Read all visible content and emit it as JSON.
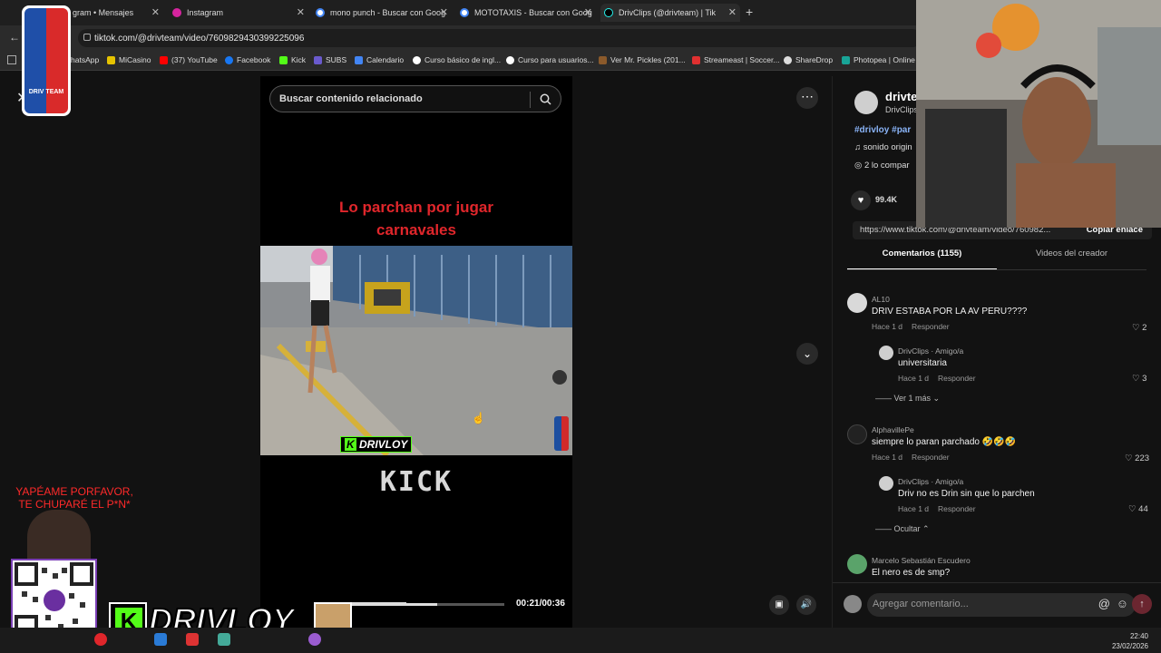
{
  "tabs": [
    {
      "label": "gram • Mensajes"
    },
    {
      "label": "Instagram"
    },
    {
      "label": "mono punch - Buscar con Goog"
    },
    {
      "label": "MOTOTAXIS - Buscar con Goog"
    },
    {
      "label": "DrivClips (@drivteam) | Tik"
    }
  ],
  "address": {
    "url": "tiktok.com/@drivteam/video/7609829430399225096"
  },
  "bookmarks": [
    "hatsApp",
    "MiCasino",
    "(37) YouTube",
    "Facebook",
    "Kick",
    "SUBS",
    "Calendario",
    "Curso básico de ingl...",
    "Curso para usuarios...",
    "Ver Mr. Pickles (201...",
    "Streameast | Soccer...",
    "ShareDrop",
    "Photopea | Online E"
  ],
  "video": {
    "search_placeholder": "Buscar contenido relacionado",
    "title_line1": "Lo parchan por jugar",
    "title_line2": "carnavales",
    "watermark": "DRIVLOY",
    "kick_logo": "KICK",
    "time": "00:21/00:36",
    "progress": 0.58
  },
  "author": {
    "handle": "drivte",
    "name": "DrivClips",
    "hashtags": "#drivloy #par",
    "sound": "sonido origin",
    "shares": "2 lo compar",
    "likes": "99.4K"
  },
  "link": {
    "url": "https://www.tiktok.com/@drivteam/video/760982...",
    "copy_label": "Copiar enlace"
  },
  "tabs_panel": {
    "comments": "Comentarios (1155)",
    "creator": "Videos del creador"
  },
  "comments": [
    {
      "name": "AL10",
      "text": "DRIV ESTABA POR LA AV PERU????",
      "time": "Hace 1 d",
      "reply": "Responder",
      "likes": "2"
    },
    {
      "name": "DrivClips · Amigo/a",
      "text": "universitaria",
      "time": "Hace 1 d",
      "reply": "Responder",
      "likes": "3"
    },
    {
      "name": "AlphavillePe",
      "text": "siempre lo paran parchado 🤣🤣🤣",
      "time": "Hace 1 d",
      "reply": "Responder",
      "likes": "223"
    },
    {
      "name": "DrivClips · Amigo/a",
      "text": "Driv no es Drin sin que lo parchen",
      "time": "Hace 1 d",
      "reply": "Responder",
      "likes": "44"
    },
    {
      "name": "Marcelo Sebastián Escudero",
      "text": "El nero es de smp?"
    }
  ],
  "more": {
    "see_more": "Ver 1 más",
    "hide": "Ocultar"
  },
  "composer": {
    "placeholder": "Agregar comentario..."
  },
  "overlay": {
    "yape_line1": "YAPÉAME PORFAVOR,",
    "yape_line2": "TE CHUPARÉ  EL P*N*",
    "logo_team": "DRIV TEAM",
    "brand": "DRIVLOY"
  },
  "clock": {
    "time": "22:40",
    "date": "23/02/2026"
  },
  "colors": {
    "accent_red": "#fe2c55",
    "title_red": "#e0262b",
    "kick_green": "#53fc18"
  }
}
